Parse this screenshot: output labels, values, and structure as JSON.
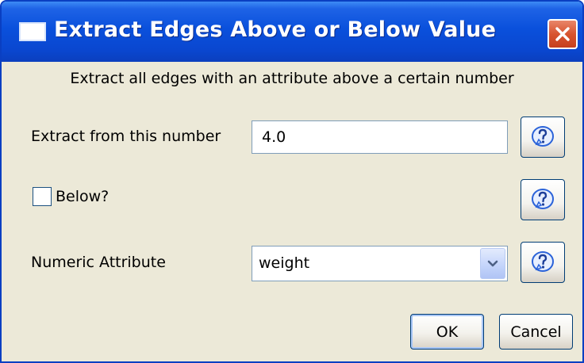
{
  "window": {
    "title": "Extract Edges Above or Below Value",
    "icons": {
      "app": "window-icon",
      "close": "close-x-icon"
    }
  },
  "description": "Extract all edges with an attribute above a certain number",
  "fields": {
    "number_label": "Extract from this number",
    "number_value": "4.0",
    "below_label": "Below?",
    "below_checked": false,
    "attribute_label": "Numeric Attribute",
    "attribute_value": "weight"
  },
  "help": {
    "icon": "help-question-icon"
  },
  "buttons": {
    "ok": "OK",
    "cancel": "Cancel"
  },
  "colors": {
    "titlebar": "#0a50dc",
    "close": "#d8542f",
    "dialog_bg": "#ece9d8",
    "help_icon": "#2b63d9"
  }
}
